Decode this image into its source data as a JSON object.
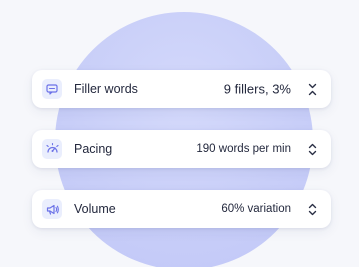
{
  "metrics": [
    {
      "label": "Filler words",
      "value": "9 fillers, 3%",
      "icon": "speech-bubble-icon",
      "toggle_icon": "collapse-chevrons-icon"
    },
    {
      "label": "Pacing",
      "value": "190 words per min",
      "icon": "gauge-icon",
      "toggle_icon": "expand-chevrons-icon"
    },
    {
      "label": "Volume",
      "value": "60% variation",
      "icon": "megaphone-icon",
      "toggle_icon": "expand-chevrons-icon"
    }
  ],
  "colors": {
    "icon_accent": "#6c72e8",
    "icon_background": "#eaeefd",
    "text": "#23283d",
    "backdrop": "#c8cef8"
  }
}
